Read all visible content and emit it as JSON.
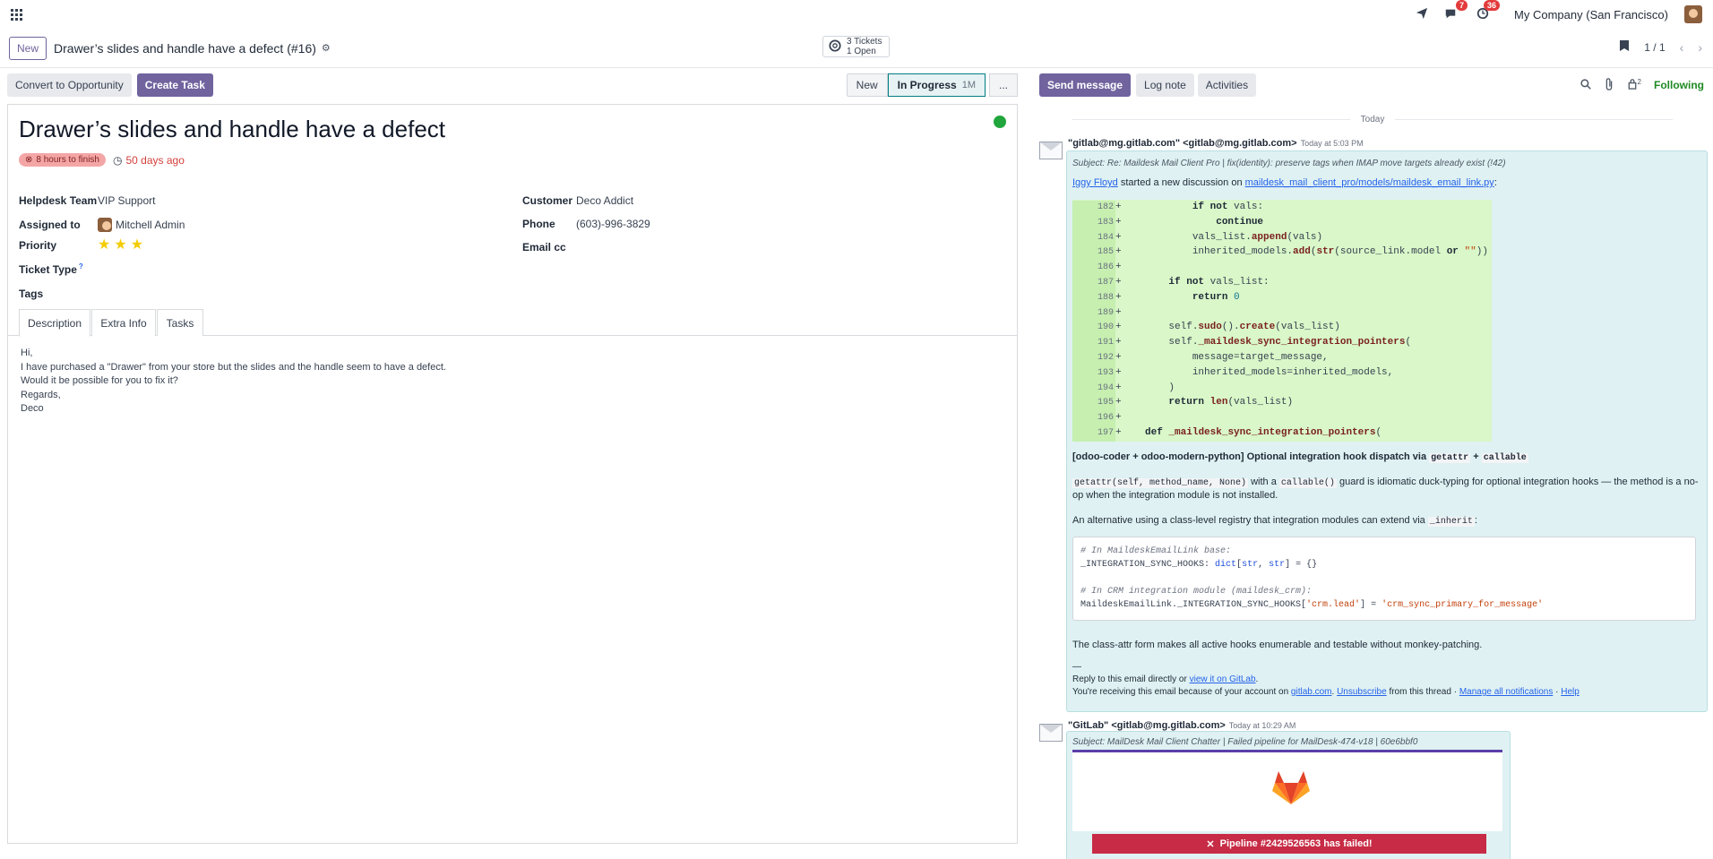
{
  "topbar": {
    "company": "My Company (San Francisco)",
    "messages_count": "7",
    "activities_count": "36"
  },
  "control_panel": {
    "new_label": "New",
    "breadcrumb_title": "Drawer’s slides and handle have a defect (#16)",
    "tickets_count": "3 Tickets",
    "tickets_open": "1 Open",
    "pager": "1 / 1"
  },
  "actions": {
    "convert_label": "Convert to Opportunity",
    "create_task_label": "Create Task"
  },
  "stages": [
    {
      "label": "New"
    },
    {
      "label": "In Progress",
      "duration": "1M",
      "active": true
    },
    {
      "label": "..."
    }
  ],
  "ticket": {
    "title": "Drawer’s slides and handle have a defect",
    "deadline_badge": "8 hours to finish",
    "age": "50 days ago",
    "status_color": "#21a63d",
    "fields": {
      "team_label": "Helpdesk Team",
      "team_value": "VIP Support",
      "assigned_label": "Assigned to",
      "assigned_value": "Mitchell Admin",
      "priority_label": "Priority",
      "priority_stars": 3,
      "type_label": "Ticket Type",
      "type_help": "?",
      "tags_label": "Tags",
      "customer_label": "Customer",
      "customer_value": "Deco Addict",
      "phone_label": "Phone",
      "phone_value": "(603)-996-3829",
      "emailcc_label": "Email cc"
    },
    "tabs": [
      "Description",
      "Extra Info",
      "Tasks"
    ],
    "description": [
      "Hi,",
      "",
      "I have purchased a \"Drawer\" from your store but the slides and the handle seem to have a defect.",
      "Would it be possible for you to fix it?",
      "",
      "Regards,",
      "Deco"
    ]
  },
  "chatter": {
    "send_message": "Send message",
    "log_note": "Log note",
    "activities": "Activities",
    "attachments_count": "2",
    "following": "Following",
    "today": "Today",
    "msg1": {
      "author": "\"gitlab@mg.gitlab.com\" <gitlab@mg.gitlab.com>",
      "time": "Today at 5:03 PM",
      "subject": "Subject: Re: Maildesk Mail Client Pro | fix(identity): preserve tags when IMAP move targets already exist (!42)",
      "intro_user": "Iggy Floyd",
      "intro_text": "started a new discussion on",
      "intro_file": "maildesk_mail_client_pro/models/maildesk_email_link.py",
      "intro_colon": ":",
      "diff_numbers": [
        "182",
        "183",
        "184",
        "185",
        "186",
        "187",
        "188",
        "189",
        "190",
        "191",
        "192",
        "193",
        "194",
        "195",
        "196",
        "197"
      ],
      "heading_prefix": "[odoo-coder + odoo-modern-python] Optional integration hook dispatch via",
      "heading_code1": "getattr",
      "heading_plus": "+",
      "heading_code2": "callable",
      "para1_code1": "getattr(self, method_name, None)",
      "para1_mid": "with a",
      "para1_code2": "callable()",
      "para1_rest": "guard is idiomatic duck-typing for optional integration hooks — the method is a no-",
      "para1_line2": "op when the integration module is not installed.",
      "para2": "An alternative using a class-level registry that integration modules can extend via",
      "para2_code": "_inherit",
      "para2_end": ":",
      "para3": "The class-attr form makes all active hooks enumerable and testable without monkey-patching.",
      "dash": "—",
      "reply_text": "Reply to this email directly or",
      "reply_link": "view it on GitLab",
      "receiving_text": "You're receiving this email because of your account on",
      "gitlab_link": "gitlab.com",
      "unsubscribe": "Unsubscribe",
      "from_thread": "from this thread ·",
      "manage": "Manage all notifications",
      "help": "Help"
    },
    "msg2": {
      "author": "\"GitLab\" <gitlab@mg.gitlab.com>",
      "time": "Today at 10:29 AM",
      "subject": "Subject: MailDesk Mail Client Chatter | Failed pipeline for MailDesk-474-v18 | 60e6bbf0",
      "pipeline": "Pipeline #2429526563 has failed!"
    }
  },
  "colors": {
    "primary": "#71639e",
    "chatter_bg": "#dff1f2",
    "danger": "#d23f3a",
    "following": "#1f8b24",
    "diff_bg": "#d9f7c8"
  }
}
